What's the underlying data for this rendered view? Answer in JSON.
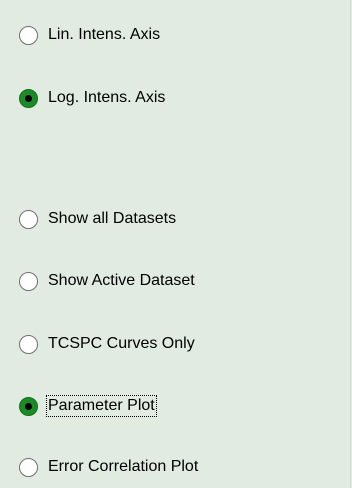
{
  "axis_options": [
    {
      "label": "Lin. Intens. Axis",
      "checked": false
    },
    {
      "label": "Log. Intens. Axis",
      "checked": true
    }
  ],
  "display_options": [
    {
      "label": "Show all Datasets",
      "checked": false
    },
    {
      "label": "Show Active Dataset",
      "checked": false
    },
    {
      "label": "TCSPC Curves Only",
      "checked": false
    },
    {
      "label": "Parameter Plot",
      "checked": true,
      "focused": true
    },
    {
      "label": "Error Correlation Plot",
      "checked": false
    }
  ],
  "colors": {
    "panel_background": "#e2ebe1",
    "radio_selected": "#1c8a27"
  }
}
